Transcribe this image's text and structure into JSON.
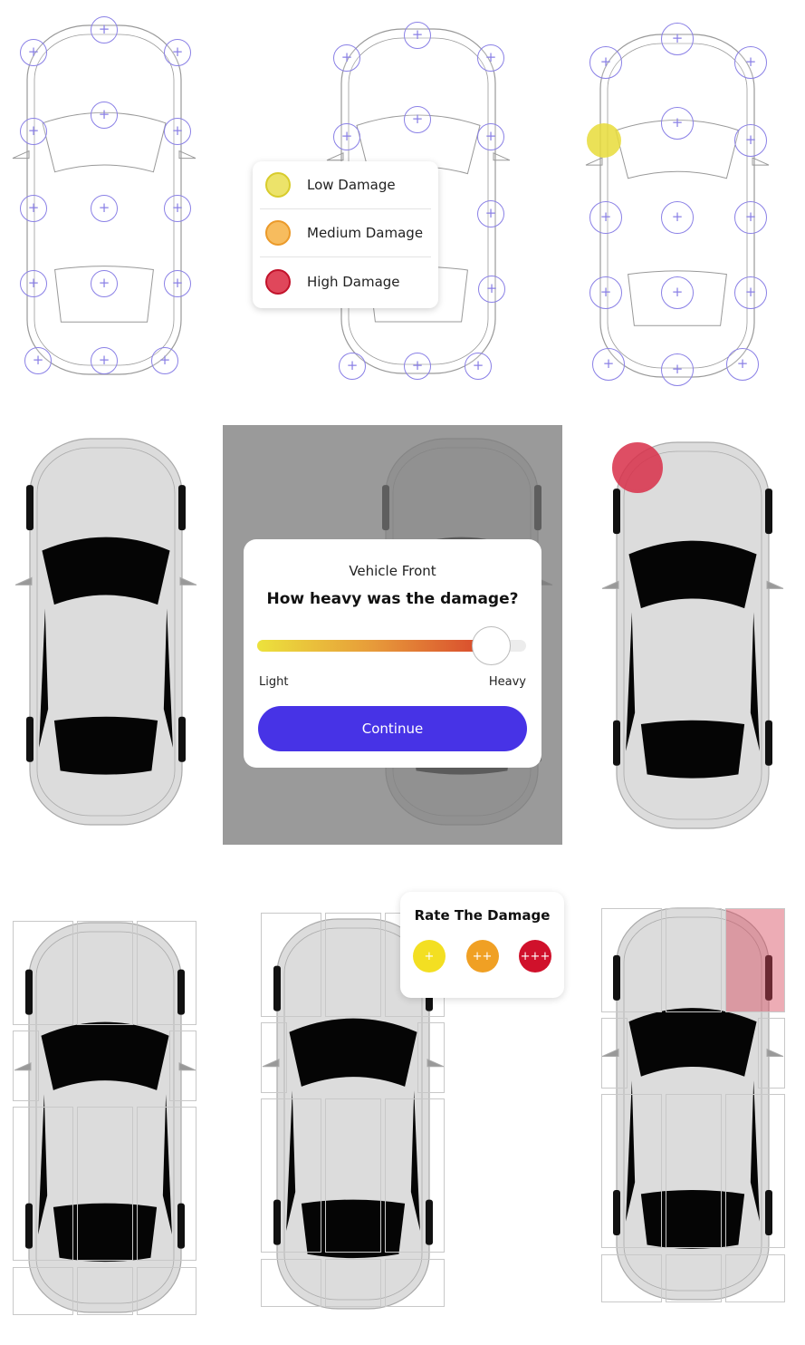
{
  "legend": {
    "items": [
      {
        "label": "Low Damage",
        "color": "#ece36a",
        "border": "#d8cc2c"
      },
      {
        "label": "Medium Damage",
        "color": "#f7bc5e",
        "border": "#eb9a2a"
      },
      {
        "label": "High Damage",
        "color": "#e0475b",
        "border": "#c2132b"
      }
    ]
  },
  "modal": {
    "subtitle": "Vehicle Front",
    "title": "How heavy was the damage?",
    "slider_value": 0.87,
    "min_label": "Light",
    "max_label": "Heavy",
    "continue_label": "Continue",
    "accent": "#4733e6"
  },
  "rate": {
    "title": "Rate The Damage",
    "options": [
      {
        "label": "+",
        "color": "#f3df22"
      },
      {
        "label": "++",
        "color": "#f0a024"
      },
      {
        "label": "+++",
        "color": "#d0112b"
      }
    ]
  },
  "markers": {
    "plus_color": "#8a80e6",
    "low": "#e8dc3a",
    "high": "#d9304a"
  }
}
